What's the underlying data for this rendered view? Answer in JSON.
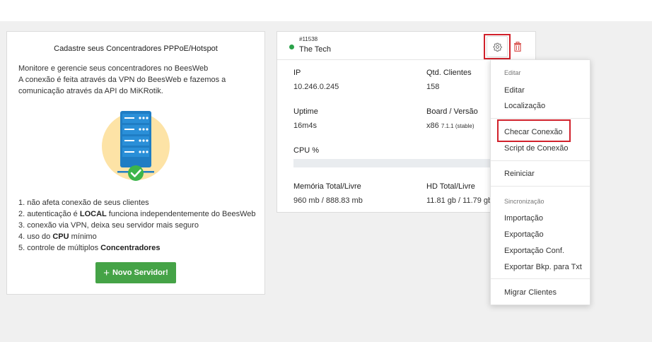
{
  "left_card": {
    "title": "Cadastre seus Concentradores PPPoE/Hotspot",
    "intro_line1": "Monitore e gerencie seus concentradores no BeesWeb",
    "intro_line2": "A conexão é feita através da VPN do BeesWeb e fazemos a comunicação através da API do MiKRotik.",
    "benefits": [
      {
        "pre": "1. não afeta conexão de seus clientes",
        "bold": "",
        "post": ""
      },
      {
        "pre": "2. autenticação é ",
        "bold": "LOCAL",
        "post": " funciona independentemente do BeesWeb"
      },
      {
        "pre": "3. conexão via VPN, deixa seu servidor mais seguro",
        "bold": "",
        "post": ""
      },
      {
        "pre": "4. uso do ",
        "bold": "CPU",
        "post": " mínimo"
      },
      {
        "pre": "5. controle de múltiplos ",
        "bold": "Concentradores",
        "post": ""
      }
    ],
    "new_server_label": "Novo Servidor!"
  },
  "server": {
    "id": "#11538",
    "name": "The Tech",
    "status_color": "#2aa24a",
    "ip_label": "IP",
    "ip_value": "10.246.0.245",
    "clients_label": "Qtd. Clientes",
    "clients_value": "158",
    "uptime_label": "Uptime",
    "uptime_value": "16m4s",
    "board_label": "Board / Versão",
    "board_value": "x86",
    "board_version": "7.1.1 (stable)",
    "cpu_label": "CPU %",
    "cpu_percent": 0,
    "memory_label": "Memória Total/Livre",
    "memory_value": "960 mb / 888.83 mb",
    "hd_label": "HD Total/Livre",
    "hd_value": "11.81 gb / 11.79 gb"
  },
  "dropdown": {
    "header_edit": "Editar",
    "edit": "Editar",
    "location": "Localização",
    "check_connection": "Checar Conexão",
    "connection_script": "Script de Conexão",
    "restart": "Reiniciar",
    "header_sync": "Sincronização",
    "import": "Importação",
    "export": "Exportação",
    "export_conf": "Exportação Conf.",
    "export_backup": "Exportar Bkp. para Txt",
    "migrate_clients": "Migrar Clientes"
  },
  "colors": {
    "accent_green": "#45a347",
    "highlight_red": "#d1212b",
    "trash_red": "#d9534f"
  }
}
